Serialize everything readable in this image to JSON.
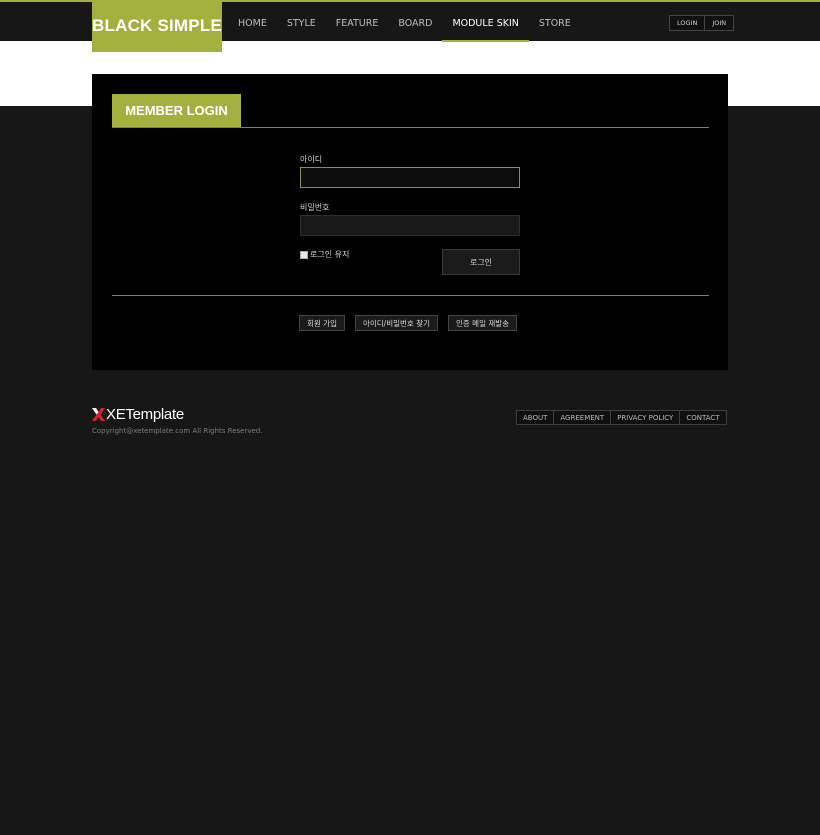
{
  "header": {
    "logo": "BLACK SIMPLE",
    "nav": [
      {
        "label": "HOME",
        "active": false
      },
      {
        "label": "STYLE",
        "active": false
      },
      {
        "label": "FEATURE",
        "active": false
      },
      {
        "label": "BOARD",
        "active": false
      },
      {
        "label": "MODULE SKIN",
        "active": true
      },
      {
        "label": "STORE",
        "active": false
      }
    ],
    "account": {
      "login": "LOGIN",
      "join": "JOIN"
    }
  },
  "login_panel": {
    "title": "MEMBER LOGIN",
    "id_label": "아이디",
    "id_value": "",
    "password_label": "비밀번호",
    "password_value": "",
    "remember_label": "로그인 유지",
    "remember_checked": false,
    "submit_label": "로그인",
    "links": {
      "signup": "회원 가입",
      "find_account": "아이디/비밀번호 찾기",
      "resend_auth": "인증 메일 재발송"
    }
  },
  "footer": {
    "brand": "XETemplate",
    "copyright": "Copyright@xetemplate.com All Rights Reserved.",
    "links": [
      "ABOUT",
      "AGREEMENT",
      "PRIVACY POLICY",
      "CONTACT"
    ]
  },
  "colors": {
    "accent": "#a3b03e",
    "background": "#171717",
    "panel": "#000000",
    "logo_mark": "#d8222a"
  },
  "icons": {
    "footer_logo": "x-logo-icon"
  }
}
